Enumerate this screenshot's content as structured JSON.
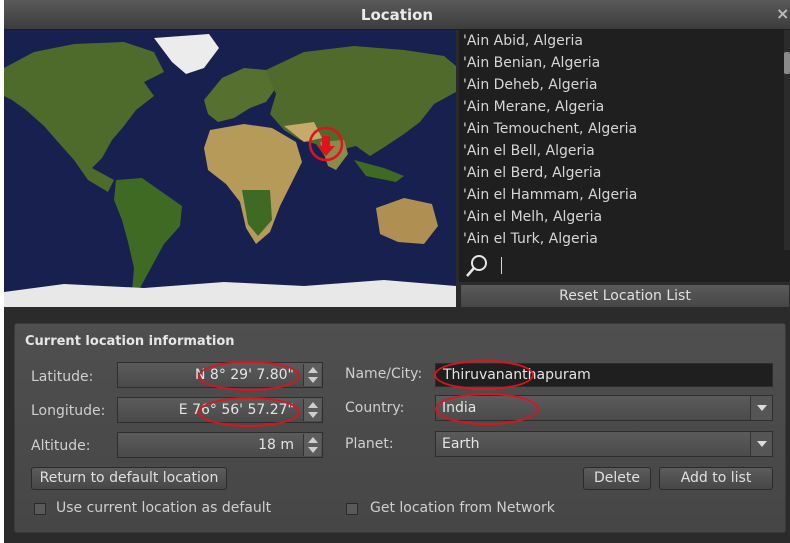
{
  "window": {
    "title": "Location",
    "close_glyph": "×"
  },
  "city_list": {
    "items": [
      "'Ain Abid, Algeria",
      "'Ain Benian, Algeria",
      "'Ain Deheb, Algeria",
      "'Ain Merane, Algeria",
      "'Ain Temouchent, Algeria",
      "'Ain el Bell, Algeria",
      "'Ain el Berd, Algeria",
      "'Ain el Hammam, Algeria",
      "'Ain el Melh, Algeria",
      "'Ain el Turk, Algeria"
    ],
    "search_value": "",
    "reset_label": "Reset Location List"
  },
  "info": {
    "heading": "Current location information",
    "latitude_label": "Latitude:",
    "latitude_value": "N 8° 29' 7.80\"",
    "longitude_label": "Longitude:",
    "longitude_value": "E 76° 56' 57.27\"",
    "altitude_label": "Altitude:",
    "altitude_value": "18 m",
    "name_label": "Name/City:",
    "name_value": "Thiruvananthapuram",
    "country_label": "Country:",
    "country_value": "India",
    "planet_label": "Planet:",
    "planet_value": "Earth",
    "return_label": "Return to default location",
    "delete_label": "Delete",
    "add_label": "Add to list",
    "use_default_label": "Use current location as default",
    "use_default_checked": false,
    "network_label": "Get location from Network",
    "network_checked": false
  },
  "colors": {
    "annotation": "#e0121d",
    "map_ocean": "#17204f",
    "panel_bg": "#4b4b4b"
  },
  "icons": [
    "search-icon",
    "location-marker-icon",
    "spin-up-icon",
    "spin-down-icon",
    "dropdown-arrow-icon",
    "close-icon"
  ]
}
